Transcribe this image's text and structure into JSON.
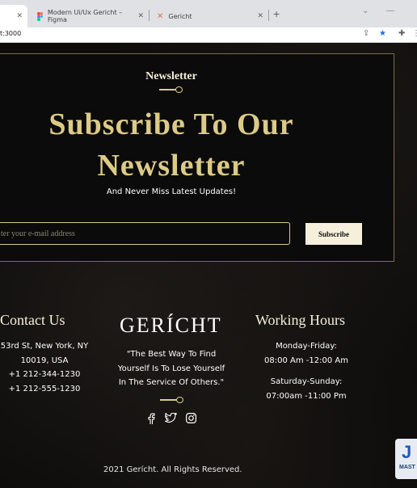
{
  "browser": {
    "tabs": [
      {
        "title": "Modern Ui/Ux Gericht – Figma"
      },
      {
        "title": "Gericht"
      }
    ],
    "new_tab_symbol": "+",
    "url": "t:3000"
  },
  "newsletter": {
    "subheading": "Newsletter",
    "title": "Subscribe To Our Newsletter",
    "tagline": "And Never Miss Latest Updates!",
    "email_placeholder": "ter your e-mail address",
    "subscribe_label": "Subscribe"
  },
  "footer": {
    "contact": {
      "title": "Contact Us",
      "lines": [
        "53rd St, New York, NY",
        "10019, USA",
        "+1 212-344-1230",
        "+1 212-555-1230"
      ]
    },
    "brand": {
      "logo": "GERÍCHT",
      "quote_lines": [
        "\"The Best Way To Find",
        "Yourself Is To Lose Yourself",
        "In The Service Of Others.\""
      ]
    },
    "hours": {
      "title": "Working Hours",
      "weekday_label": "Monday-Friday:",
      "weekday_time": "08:00 Am -12:00 Am",
      "weekend_label": "Saturday-Sunday:",
      "weekend_time": "07:00am -11:00 Pm"
    },
    "copyright": "2021 Gerícht. All Rights Reserved."
  },
  "watermark": {
    "letter": "J",
    "text": "MAST"
  },
  "colors": {
    "gold": "#dcca87",
    "cream": "#f5efdb",
    "black": "#0c0c0c"
  },
  "icons": [
    "facebook-icon",
    "twitter-icon",
    "instagram-icon",
    "close-icon",
    "share-icon",
    "star-icon",
    "extensions-icon"
  ]
}
